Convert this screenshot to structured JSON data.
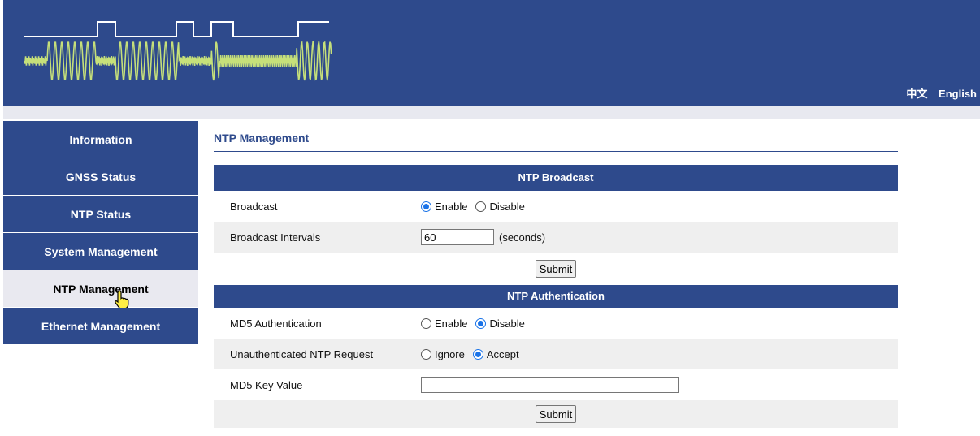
{
  "header": {
    "lang_chinese": "中文",
    "lang_english": "English",
    "colors": {
      "brand": "#2e4a8c",
      "wave": "#c6e07a",
      "pulse": "#ffffff"
    }
  },
  "sidebar": {
    "items": [
      {
        "label": "Information",
        "active": false
      },
      {
        "label": "GNSS Status",
        "active": false
      },
      {
        "label": "NTP Status",
        "active": false
      },
      {
        "label": "System Management",
        "active": false
      },
      {
        "label": "NTP Management",
        "active": true
      },
      {
        "label": "Ethernet Management",
        "active": false
      }
    ]
  },
  "main": {
    "title": "NTP Management",
    "broadcast": {
      "heading": "NTP Broadcast",
      "broadcast_label": "Broadcast",
      "enable_label": "Enable",
      "disable_label": "Disable",
      "broadcast_selected": "Enable",
      "intervals_label": "Broadcast Intervals",
      "intervals_value": "60",
      "intervals_unit": "(seconds)",
      "submit_label": "Submit"
    },
    "auth": {
      "heading": "NTP Authentication",
      "md5_label": "MD5 Authentication",
      "enable_label": "Enable",
      "disable_label": "Disable",
      "md5_selected": "Disable",
      "unauth_label": "Unauthenticated NTP Request",
      "ignore_label": "Ignore",
      "accept_label": "Accept",
      "unauth_selected": "Accept",
      "key_label": "MD5 Key Value",
      "key_value": "",
      "submit_label": "Submit"
    }
  }
}
